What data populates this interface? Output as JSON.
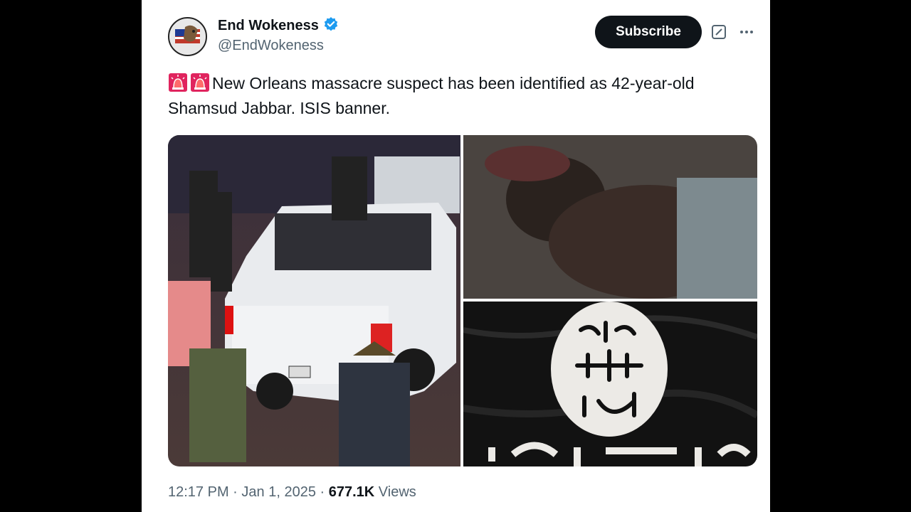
{
  "post": {
    "author_name": "End Wokeness",
    "handle": "@EndWokeness",
    "subscribe_label": "Subscribe",
    "text": "New Orleans massacre suspect has been identified as 42-year-old Shamsud Jabbar. ISIS banner.",
    "time": "12:17 PM",
    "date": "Jan 1, 2025",
    "views_count": "677.1K",
    "views_label": "Views",
    "separator": "·"
  },
  "icons": [
    "verified-badge-icon",
    "grok-icon",
    "more-icon",
    "siren-icon"
  ],
  "colors": {
    "accent": "#1d9bf0",
    "text": "#0f1419",
    "muted": "#536471",
    "button": "#0f1419"
  }
}
